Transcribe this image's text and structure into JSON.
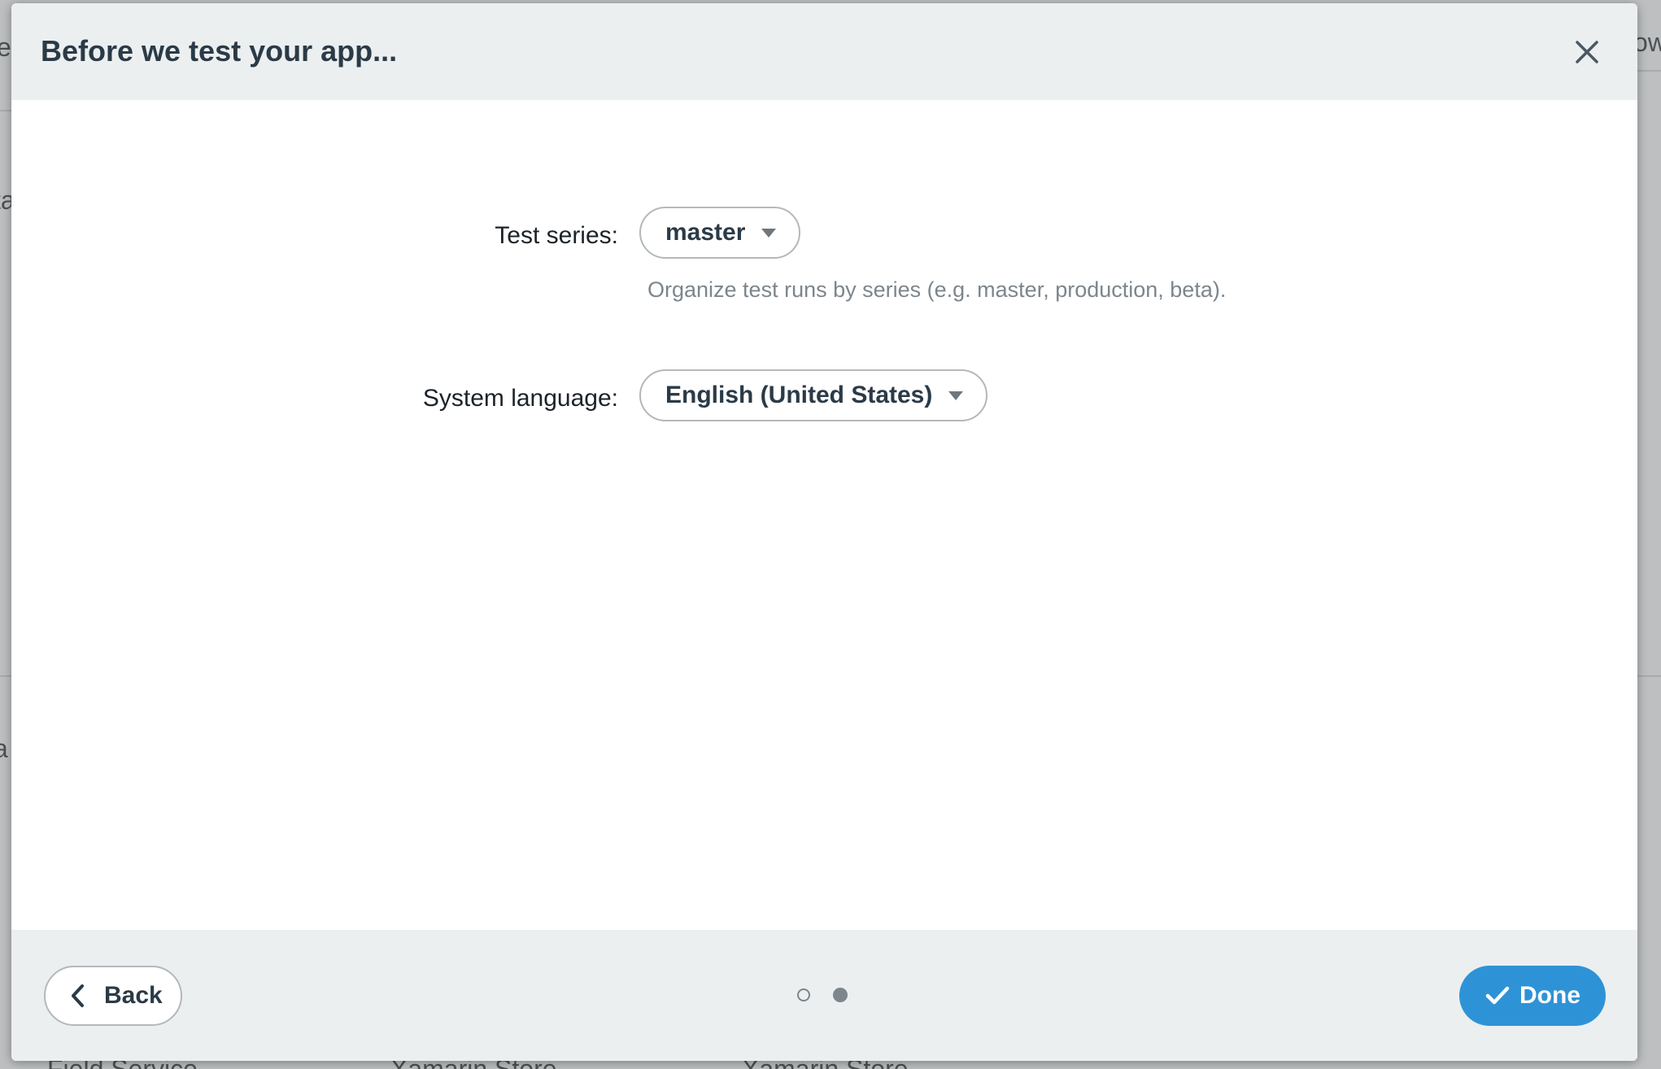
{
  "background": {
    "top_left_fragment": "e",
    "top_right_fragment": "ow",
    "left_fragment_1": "ta",
    "left_fragment_2": "a",
    "bottom_items": [
      "Field Service",
      "Xamarin Store",
      "Xamarin Store"
    ]
  },
  "modal": {
    "title": "Before we test your app...",
    "close_icon": "close-icon"
  },
  "form": {
    "test_series": {
      "label": "Test series:",
      "value": "master",
      "hint": "Organize test runs by series (e.g. master, production, beta)."
    },
    "system_language": {
      "label": "System language:",
      "value": "English (United States)"
    }
  },
  "footer": {
    "back_label": "Back",
    "done_label": "Done",
    "pagination": {
      "total": 2,
      "current": 2
    }
  },
  "colors": {
    "accent": "#2e93d6",
    "header_bg": "#eceff0",
    "title_text": "#2b3a47",
    "hint_text": "#7c868c"
  }
}
